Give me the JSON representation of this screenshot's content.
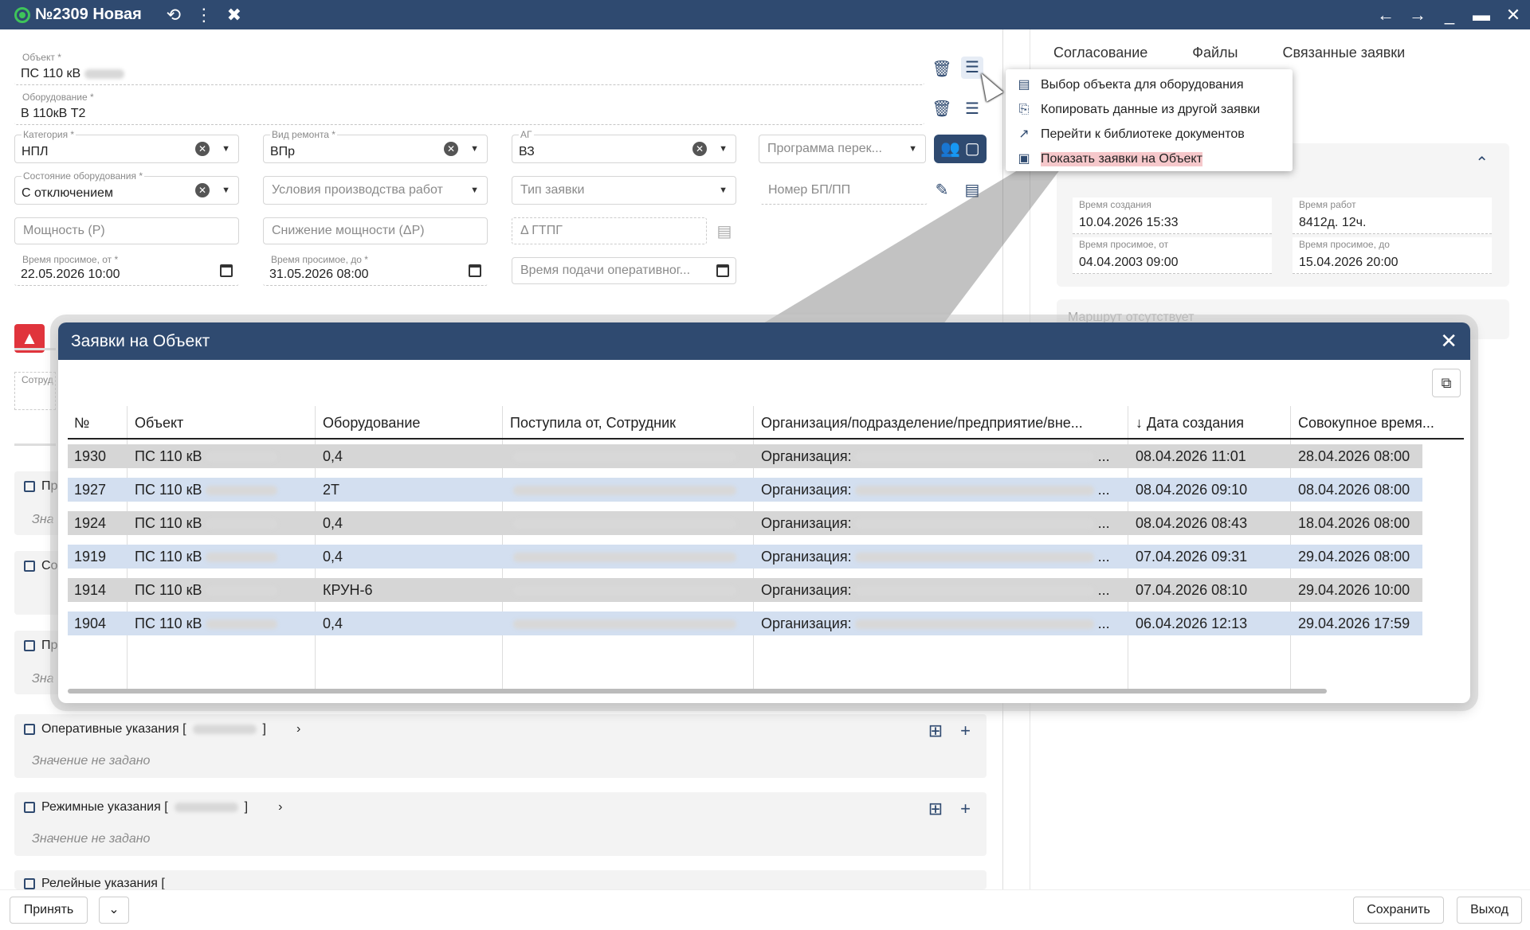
{
  "header": {
    "title": "№2309 Новая"
  },
  "form": {
    "object": {
      "label": "Объект *",
      "value": "ПС 110 кВ"
    },
    "equipment": {
      "label": "Оборудование *",
      "value": "В 110кВ Т2"
    },
    "category": {
      "label": "Категория *",
      "value": "НПЛ"
    },
    "repair_type": {
      "label": "Вид ремонта *",
      "value": "ВПр"
    },
    "ag": {
      "label": "АГ",
      "value": "ВЗ"
    },
    "program": {
      "placeholder": "Программа перек..."
    },
    "equip_state": {
      "label": "Состояние оборудования *",
      "value": "С отключением"
    },
    "work_conditions": {
      "placeholder": "Условия производства работ"
    },
    "request_type": {
      "placeholder": "Тип заявки"
    },
    "bp_number": {
      "placeholder": "Номер БП/ПП"
    },
    "power": {
      "placeholder": "Мощность (P)"
    },
    "power_drop": {
      "placeholder": "Снижение мощности (ΔP)"
    },
    "gtpg": {
      "placeholder": "Δ ГТПГ"
    },
    "time_from": {
      "label": "Время просимое, от *",
      "value": "22.05.2026 10:00"
    },
    "time_to": {
      "label": "Время просимое, до *",
      "value": "31.05.2026 08:00"
    },
    "op_time": {
      "placeholder": "Время подачи оперативног..."
    },
    "employee_label": "Сотруд"
  },
  "sections": [
    {
      "label": "Пр",
      "empty": "Зна"
    },
    {
      "label": "Со",
      "empty": ""
    },
    {
      "label": "Пр",
      "empty": "Зна"
    },
    {
      "label": "Оперативные указания [",
      "empty": "Значение не задано"
    },
    {
      "label": "Режимные указания [",
      "empty": "Значение не задано"
    },
    {
      "label": "Релейные указания [",
      "empty": ""
    }
  ],
  "right": {
    "tabs": [
      "Согласование",
      "Файлы",
      "Связанные заявки"
    ],
    "created": {
      "label": "Время создания",
      "value": "10.04.2026 15:33"
    },
    "work_time": {
      "label": "Время работ",
      "value": "8412д. 12ч."
    },
    "req_from": {
      "label": "Время просимое, от",
      "value": "04.04.2003 09:00"
    },
    "req_to": {
      "label": "Время просимое, до",
      "value": "15.04.2026 20:00"
    },
    "route": "Маршрут отсутствует"
  },
  "context_menu": {
    "items": [
      {
        "icon": "list-icon",
        "label": "Выбор объекта для оборудования"
      },
      {
        "icon": "copy-icon",
        "label": "Копировать данные из другой заявки"
      },
      {
        "icon": "external-link-icon",
        "label": "Перейти к библиотеке документов"
      },
      {
        "icon": "image-icon",
        "label": "Показать заявки на Объект"
      }
    ]
  },
  "modal": {
    "title": "Заявки на Объект",
    "columns": [
      "№",
      "Объект",
      "Оборудование",
      "Поступила от, Сотрудник",
      "Организация/подразделение/предприятие/вне...",
      "Дата создания",
      "Совокупное время..."
    ],
    "rows": [
      {
        "num": "1930",
        "object": "ПС 110 кВ",
        "equipment": "0,4",
        "org": "Организация:",
        "created": "08.04.2026 11:01",
        "total": "28.04.2026 08:00"
      },
      {
        "num": "1927",
        "object": "ПС 110 кВ",
        "equipment": "2Т",
        "org": "Организация:",
        "created": "08.04.2026 09:10",
        "total": "08.04.2026 08:00"
      },
      {
        "num": "1924",
        "object": "ПС 110 кВ",
        "equipment": "0,4",
        "org": "Организация:",
        "created": "08.04.2026 08:43",
        "total": "18.04.2026 08:00"
      },
      {
        "num": "1919",
        "object": "ПС 110 кВ",
        "equipment": "0,4",
        "org": "Организация:",
        "created": "07.04.2026 09:31",
        "total": "29.04.2026 08:00"
      },
      {
        "num": "1914",
        "object": "ПС 110 кВ",
        "equipment": "КРУН-6",
        "org": "Организация:",
        "created": "07.04.2026 08:10",
        "total": "29.04.2026 10:00"
      },
      {
        "num": "1904",
        "object": "ПС 110 кВ",
        "equipment": "0,4",
        "org": "Организация:",
        "created": "06.04.2026 12:13",
        "total": "29.04.2026 17:59"
      }
    ]
  },
  "footer": {
    "accept": "Принять",
    "save": "Сохранить",
    "exit": "Выход"
  },
  "colors": {
    "header": "#2f4a70",
    "accent_red": "#e0343c",
    "row_odd": "#d6d6d6",
    "row_even": "#d3dff0",
    "status_green": "#3ec45a"
  }
}
